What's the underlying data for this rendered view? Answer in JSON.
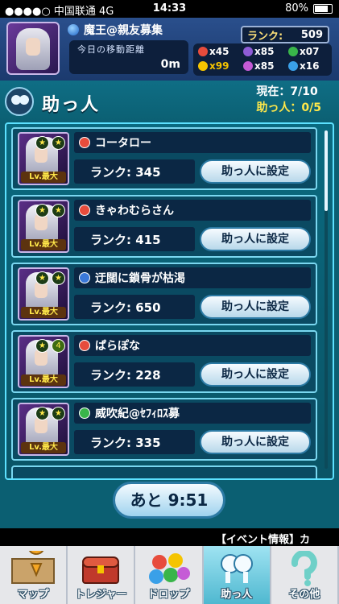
{
  "status_bar": {
    "carrier": "●●●●○ 中国联通  4G",
    "time": "14:33",
    "battery": "80%"
  },
  "header": {
    "player_name": "魔王@親友募集",
    "rank_label": "ランク:",
    "rank_value": "509",
    "distance_label": "今日の移動距離",
    "distance_value": "0m",
    "counts": [
      {
        "color": "#e74c3c",
        "value": "x45"
      },
      {
        "color": "#8e5cd6",
        "value": "x85"
      },
      {
        "color": "#39b54a",
        "value": "x07"
      },
      {
        "color": "#f5c400",
        "value": "x99"
      },
      {
        "color": "#c55bd6",
        "value": "x85"
      },
      {
        "color": "#3aa0e8",
        "value": "x16"
      }
    ]
  },
  "title": {
    "text": "助っ人",
    "current": "現在：7/10",
    "helpers": "助っ人：0/5"
  },
  "helpers": [
    {
      "name": "コータロー",
      "attr_color": "#e74c3c",
      "rank": "ランク: 345",
      "star_right": "★",
      "button": "助っ人に設定"
    },
    {
      "name": "きゃわむらさん",
      "attr_color": "#e74c3c",
      "rank": "ランク: 415",
      "star_right": "★",
      "button": "助っ人に設定"
    },
    {
      "name": "迂闊に鎖骨が枯渇",
      "attr_color": "#3a78d8",
      "rank": "ランク: 650",
      "star_right": "★",
      "button": "助っ人に設定"
    },
    {
      "name": "ぱらぽな",
      "attr_color": "#e74c3c",
      "rank": "ランク: 228",
      "star_right": "4",
      "button": "助っ人に設定"
    },
    {
      "name": "威吹紀@ｾﾌｨﾛｽ募",
      "attr_color": "#39b54a",
      "rank": "ランク: 335",
      "star_right": "★",
      "button": "助っ人に設定"
    }
  ],
  "level_label": "Lv.最大",
  "timer": "あと 9:51",
  "ticker": "【イベント情報】カ",
  "nav": [
    {
      "label": "マップ"
    },
    {
      "label": "トレジャー"
    },
    {
      "label": "ドロップ"
    },
    {
      "label": "助っ人"
    },
    {
      "label": "その他"
    }
  ]
}
